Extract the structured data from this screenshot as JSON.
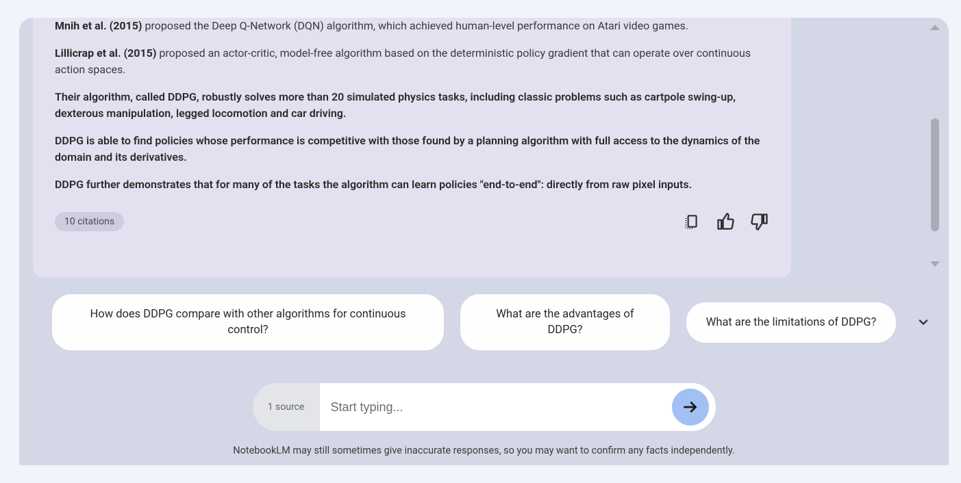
{
  "response": {
    "paragraphs": [
      {
        "type": "mixed",
        "author": "Mnih et al. (2015)",
        "text": " proposed the Deep Q-Network (DQN) algorithm, which achieved human-level performance on Atari video games."
      },
      {
        "type": "mixed",
        "author": "Lillicrap et al. (2015)",
        "text": " proposed an actor-critic, model-free algorithm based on the deterministic policy gradient that can operate over continuous action spaces."
      },
      {
        "type": "bold",
        "text": "Their algorithm, called DDPG, robustly solves more than 20 simulated physics tasks, including classic problems such as cartpole swing-up, dexterous manipulation, legged locomotion and car driving."
      },
      {
        "type": "bold",
        "text": "DDPG is able to find policies whose performance is competitive with those found by a planning algorithm with full access to the dynamics of the domain and its derivatives."
      },
      {
        "type": "bold",
        "text": "DDPG further demonstrates that for many of the tasks the algorithm can learn policies \"end-to-end\": directly from raw pixel inputs."
      }
    ],
    "citations_label": "10 citations"
  },
  "suggestions": [
    "How does DDPG compare with other algorithms for continuous control?",
    "What are the advantages of DDPG?",
    "What are the limitations of DDPG?"
  ],
  "input": {
    "source_label": "1 source",
    "placeholder": "Start typing..."
  },
  "disclaimer": "NotebookLM may still sometimes give inaccurate responses, so you may want to confirm any facts independently."
}
